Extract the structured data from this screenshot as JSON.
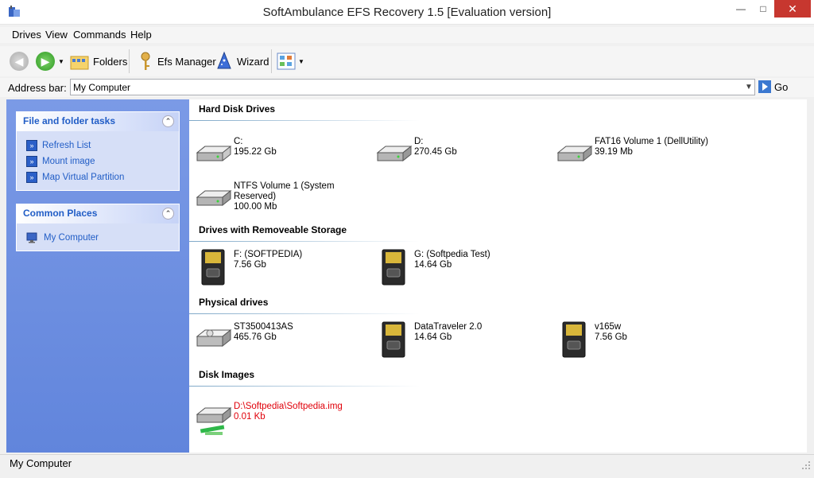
{
  "window": {
    "title": "SoftAmbulance EFS Recovery 1.5 [Evaluation version]"
  },
  "menu": [
    "Drives",
    "View",
    "Commands",
    "Help"
  ],
  "toolbar": {
    "folders": "Folders",
    "efs_manager": "Efs Manager",
    "wizard": "Wizard"
  },
  "address": {
    "label": "Address bar:",
    "value": "My Computer",
    "go": "Go"
  },
  "sidebar": {
    "tasks_title": "File and folder tasks",
    "tasks": [
      "Refresh List",
      "Mount image",
      "Map Virtual Partition"
    ],
    "places_title": "Common Places",
    "places": [
      "My Computer"
    ]
  },
  "sections": {
    "hdd": "Hard Disk Drives",
    "removable": "Drives with Removeable Storage",
    "physical": "Physical drives",
    "images": "Disk Images"
  },
  "hdd": [
    {
      "name": "C:",
      "size": "195.22 Gb"
    },
    {
      "name": "D:",
      "size": "270.45 Gb"
    },
    {
      "name": "FAT16 Volume 1 (DellUtility)",
      "size": "39.19 Mb"
    },
    {
      "name": "NTFS Volume 1 (System Reserved)",
      "size": "100.00 Mb"
    }
  ],
  "removable": [
    {
      "name": "F: (SOFTPEDIA)",
      "size": "7.56 Gb"
    },
    {
      "name": "G: (Softpedia Test)",
      "size": "14.64 Gb"
    }
  ],
  "physical": [
    {
      "name": "ST3500413AS",
      "size": "465.76 Gb"
    },
    {
      "name": "DataTraveler 2.0",
      "size": "14.64 Gb"
    },
    {
      "name": "v165w",
      "size": "7.56 Gb"
    }
  ],
  "images": [
    {
      "name": "D:\\Softpedia\\Softpedia.img",
      "size": "0.01 Kb"
    }
  ],
  "status": {
    "text": "My Computer"
  },
  "colors": {
    "sidebar": "#6b8ee0",
    "link": "#215dc6",
    "image_text": "#e0000a"
  }
}
